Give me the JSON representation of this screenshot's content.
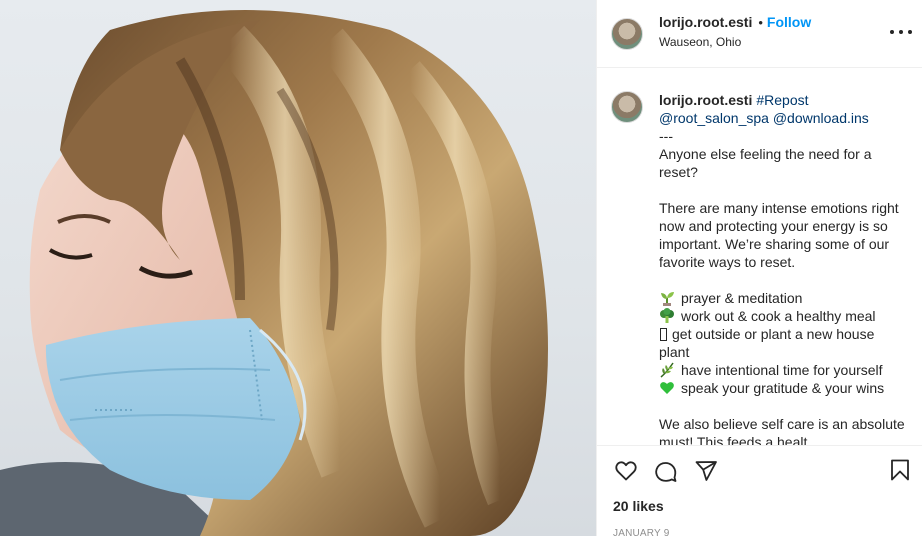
{
  "header": {
    "username": "lorijo.root.esti",
    "separator": "•",
    "follow_label": "Follow",
    "location": "Wauseon, Ohio",
    "more_icon": "more-options-icon"
  },
  "caption": {
    "username": "lorijo.root.esti",
    "hashtag": "#Repost",
    "mention1": "@root_salon_spa",
    "mention2": "@download.ins",
    "divider": "---",
    "para1": "Anyone else feeling the need for a reset?",
    "para2": "There are many intense emotions right now and protecting your energy is so important. We’re sharing some of our favorite ways to reset.",
    "items": [
      {
        "icon": "sprout-icon",
        "text": "prayer & meditation"
      },
      {
        "icon": "broccoli-icon",
        "text": "work out & cook a healthy meal"
      },
      {
        "icon": "missing-glyph",
        "text": "get outside or plant a new house plant"
      },
      {
        "icon": "herb-icon",
        "text": "have intentional time for yourself"
      },
      {
        "icon": "green-heart-icon",
        "text": "speak your gratitude & your wins"
      }
    ],
    "para3": "We also believe self care is an absolute must! This feeds a healt"
  },
  "actions": {
    "like_icon": "heart-icon",
    "comment_icon": "comment-icon",
    "share_icon": "share-icon",
    "save_icon": "bookmark-icon",
    "likes": "20 likes",
    "date": "JANUARY 9"
  },
  "colors": {
    "link_blue": "#0095f6",
    "mention": "#00376b",
    "text": "#262626",
    "muted": "#8e8e8e",
    "border": "#efefef"
  }
}
